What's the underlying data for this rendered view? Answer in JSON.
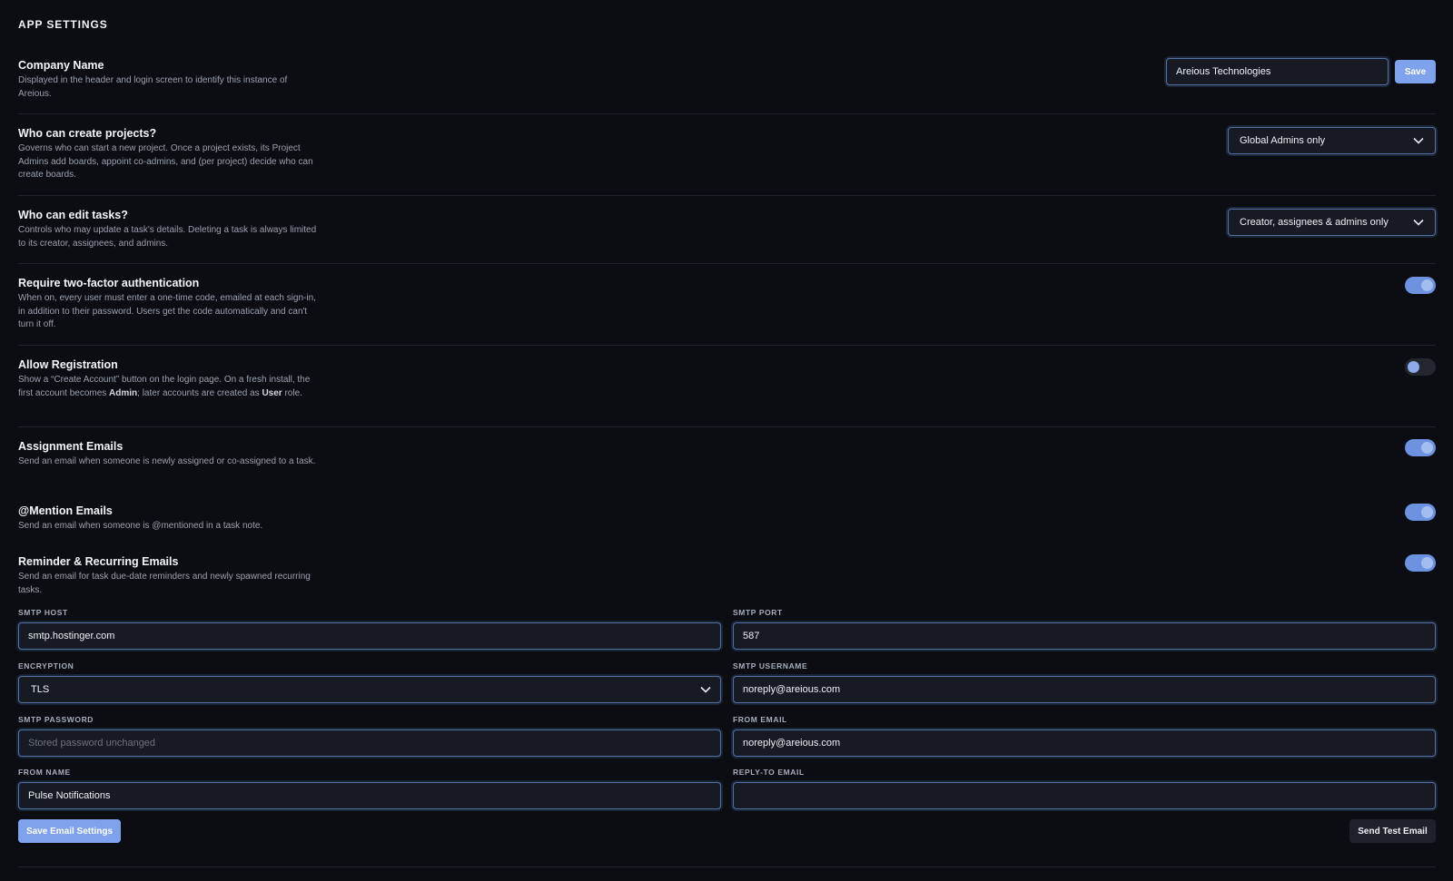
{
  "page_title": "APP SETTINGS",
  "company": {
    "title": "Company Name",
    "description": "Displayed in the header and login screen to identify this instance of Areious.",
    "value": "Areious Technologies",
    "save_label": "Save"
  },
  "create_projects": {
    "title": "Who can create projects?",
    "description": "Governs who can start a new project. Once a project exists, its Project Admins add boards, appoint co-admins, and (per project) decide who can create boards.",
    "selected": "Global Admins only"
  },
  "edit_tasks": {
    "title": "Who can edit tasks?",
    "description": "Controls who may update a task's details. Deleting a task is always limited to its creator, assignees, and admins.",
    "selected": "Creator, assignees & admins only"
  },
  "two_factor": {
    "title": "Require two-factor authentication",
    "description": "When on, every user must enter a one-time code, emailed at each sign-in, in addition to their password. Users get the code automatically and can't turn it off.",
    "enabled": true
  },
  "registration": {
    "title": "Allow Registration",
    "desc_part1": "Show a “Create Account” button on the login page. On a fresh install, the first account becomes ",
    "desc_bold1": "Admin",
    "desc_part2": "; later accounts are created as ",
    "desc_bold2": "User",
    "desc_part3": " role.",
    "enabled": false
  },
  "assignment_emails": {
    "title": "Assignment Emails",
    "description": "Send an email when someone is newly assigned or co-assigned to a task.",
    "enabled": true
  },
  "mention_emails": {
    "title": "@Mention Emails",
    "description": "Send an email when someone is @mentioned in a task note.",
    "enabled": true
  },
  "reminder_emails": {
    "title": "Reminder & Recurring Emails",
    "description": "Send an email for task due-date reminders and newly spawned recurring tasks.",
    "enabled": true
  },
  "smtp": {
    "host_label": "SMTP HOST",
    "host_value": "smtp.hostinger.com",
    "port_label": "SMTP PORT",
    "port_value": "587",
    "encryption_label": "ENCRYPTION",
    "encryption_value": "TLS",
    "username_label": "SMTP USERNAME",
    "username_value": "noreply@areious.com",
    "password_label": "SMTP PASSWORD",
    "password_placeholder": "Stored password unchanged",
    "from_email_label": "FROM EMAIL",
    "from_email_value": "noreply@areious.com",
    "from_name_label": "FROM NAME",
    "from_name_value": "Pulse Notifications",
    "reply_to_label": "REPLY-TO EMAIL",
    "reply_to_value": ""
  },
  "buttons": {
    "save_email": "Save Email Settings",
    "send_test": "Send Test Email"
  },
  "colors": {
    "background": "#0b0d12",
    "accent": "#7ea2ec",
    "input_border": "#5271a6"
  }
}
